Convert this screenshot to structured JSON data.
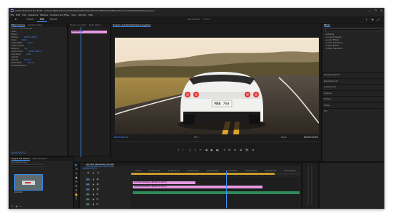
{
  "window": {
    "title": "Adobe Premiere Pro 2024 - C:\\Users\\Public\\Documents\\Adobe\\Premiere Pro\\24.0\\Tutorial\\Getting Home project\\Get Started.prproj *",
    "controls": {
      "minimize": "—",
      "maximize": "☐",
      "close": "✕"
    }
  },
  "menu": [
    "File",
    "Edit",
    "Clip",
    "Sequence",
    "Markers",
    "Graphics and Titles",
    "View",
    "Window",
    "Help"
  ],
  "header": {
    "home_icon": "home-icon",
    "tabs": [
      {
        "label": "Import",
        "active": false
      },
      {
        "label": "Edit",
        "active": true
      },
      {
        "label": "Export",
        "active": false
      }
    ],
    "sequence_title": "Get Started",
    "sequence_sub": "Edited"
  },
  "effect_controls": {
    "tabs": [
      "Effect Controls",
      "Lumetri Scopes",
      "Source: (no clips)",
      "Audio Clip M"
    ],
    "source": "Source · pink-fwid.mp4",
    "seq": "Get Started · pink-fwid.mp4",
    "clip_label": "pink-fwid.mp4",
    "sections": [
      {
        "label": "Video"
      },
      {
        "label": "Motion"
      },
      {
        "label": "Position",
        "value": "1920.0   1080.0"
      },
      {
        "label": "Scale",
        "value": "100.0"
      },
      {
        "label": "Scale Width",
        "value": "100.0"
      },
      {
        "label": "Uniform Scale"
      },
      {
        "label": "Rotation",
        "value": "0.0"
      },
      {
        "label": "Anchor Point",
        "value": "1920.0   1080.0"
      },
      {
        "label": "Anti-flicker",
        "value": "0.00"
      },
      {
        "label": "Opacity"
      },
      {
        "label": "Opacity",
        "value": "100.0 %"
      },
      {
        "label": "Blend Mode",
        "value": "Normal"
      },
      {
        "label": "Time Remapping"
      }
    ],
    "timecode": "00:00:05:12"
  },
  "program": {
    "tab": "Program: pink-fwid (Rendered) Anywhere",
    "timecode": "00:00:05:12",
    "fit": "Fit",
    "quality": "Full",
    "duration": "00:00:09:03",
    "plate": "MNB 750"
  },
  "transport": [
    "⌖",
    "⎸",
    "{",
    "}",
    "⇤",
    "◀",
    "▶",
    "▶|",
    "⇥",
    "⊞",
    "⊟",
    "⧉",
    "📷",
    "⇆"
  ],
  "effects_panel": {
    "title": "Effects",
    "search_placeholder": "",
    "items": [
      "Presets",
      "Lumetri Presets",
      "Audio Effects",
      "Audio Transitions",
      "Video Effects",
      "Video Transitions"
    ],
    "sections": [
      "Essential Graphics",
      "Essential Sound",
      "Lumetri Color",
      "Libraries",
      "Markers",
      "History",
      "Info"
    ]
  },
  "project": {
    "tabs": [
      "Project: Get Started",
      "Media Browser",
      "Libraries"
    ],
    "search": "",
    "item_label": "Get Started.prproj",
    "thumb_label": "pink-fwid"
  },
  "timeline": {
    "tab": "pink-fwid (Rendered) pink-fwid",
    "timecode": "00:00:05:12",
    "ruler": [
      "00:00",
      "00:00:01:00",
      "00:00:02:00",
      "00:00:03:00",
      "00:00:04:00",
      "00:00:05:00",
      "00:00:06:00",
      "00:00:07:00",
      "00:00:08:00"
    ],
    "tracks": [
      "V3",
      "V2",
      "V1",
      "A1",
      "A2",
      "A3"
    ],
    "clips": [
      {
        "label": "pink-fwid (Rendered)-Rendered.mp4 [V]",
        "track": "V2"
      },
      {
        "label": "pink-fwid (Rendered)-Rendered.mp4 [V]",
        "track": "V1"
      },
      {
        "label": "",
        "track": "A1"
      }
    ],
    "colors": {
      "clip_video": "#e49ae2",
      "clip_audio": "#2f8a5a",
      "accent": "#3d8ff6"
    }
  },
  "tools": [
    "▶",
    "⇥",
    "↔",
    "◆",
    "✂",
    "⬌",
    "✎",
    "✋",
    "T"
  ]
}
